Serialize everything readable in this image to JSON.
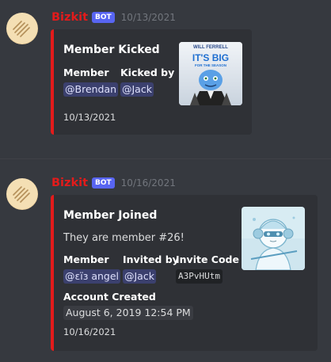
{
  "messages": [
    {
      "username": "Bizkit",
      "bot_label": "BOT",
      "timestamp": "10/13/2021",
      "avatar_icon": "bot-avatar-icon",
      "embed": {
        "title": "Member Kicked",
        "fields": [
          {
            "name": "Member",
            "value": "@Brendan"
          },
          {
            "name": "Kicked by",
            "value": "@Jack"
          }
        ],
        "footer": "10/13/2021",
        "thumbnail": {
          "top_text": "WILL FERRELL",
          "big_text": "IT'S BIG",
          "small_text": "FOR THE SEASON"
        }
      }
    },
    {
      "username": "Bizkit",
      "bot_label": "BOT",
      "timestamp": "10/16/2021",
      "avatar_icon": "bot-avatar-icon",
      "embed": {
        "title": "Member Joined",
        "description": "They are member #26!",
        "fields": [
          {
            "name": "Member",
            "value": "@εïз angel"
          },
          {
            "name": "Invited by",
            "value": "@Jack"
          },
          {
            "name": "Invite Code",
            "value": "A3PvHUtm"
          },
          {
            "name": "Account Created",
            "value": "August 6, 2019 12:54 PM"
          }
        ],
        "footer": "10/16/2021",
        "thumbnail": {
          "icon": "user-avatar-thumbnail"
        }
      }
    }
  ],
  "colors": {
    "background": "#36393f",
    "embed_bg": "#2f3136",
    "accent": "#e31b1b",
    "bot_badge": "#5865f2",
    "mention_bg": "#414675"
  }
}
